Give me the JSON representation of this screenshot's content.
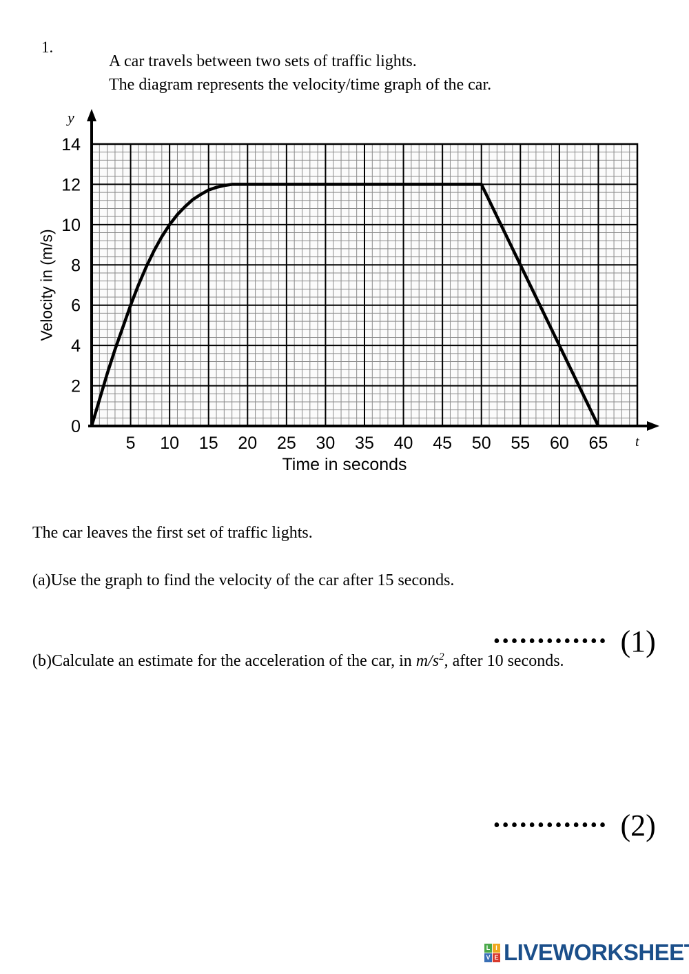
{
  "question": {
    "number": "1.",
    "lines": [
      "A car travels between two sets of traffic lights.",
      "The diagram represents the velocity/time graph of the car."
    ]
  },
  "body": {
    "lead": "The car leaves the first set of traffic lights.",
    "part_a": "(a)Use the graph to find the velocity of the car after 15 seconds.",
    "part_b_pre": "(b)Calculate an estimate for the acceleration of the car, in ",
    "part_b_units": "m/s",
    "part_b_exp": "2",
    "part_b_post": ", after 10 seconds.",
    "answer_dots": "•••••••••••••",
    "mark_a": "(1)",
    "mark_b": "(2)"
  },
  "footer": {
    "logo_tiles": [
      {
        "letter": "L",
        "color": "#4aa94a"
      },
      {
        "letter": "I",
        "color": "#f0a81e"
      },
      {
        "letter": "V",
        "color": "#3a6fb5"
      },
      {
        "letter": "E",
        "color": "#d83a2e"
      }
    ],
    "logo_word": "LIVEWORKSHEETS",
    "logo_word_color": "#1b4f8a"
  },
  "chart_data": {
    "type": "line",
    "title": "",
    "xlabel": "Time in seconds",
    "ylabel": "Velocity in (m/s)",
    "x_axis_symbol": "t",
    "y_axis_symbol": "y",
    "xlim": [
      0,
      70
    ],
    "ylim": [
      0,
      14
    ],
    "xticks": [
      5,
      10,
      15,
      20,
      25,
      30,
      35,
      40,
      45,
      50,
      55,
      60,
      65
    ],
    "yticks": [
      0,
      2,
      4,
      6,
      8,
      10,
      12,
      14
    ],
    "grid": "on",
    "grid_major_x": 5,
    "grid_minor_x": 1,
    "grid_major_y": 2,
    "grid_minor_y": 0.4,
    "series": [
      {
        "name": "velocity",
        "points": [
          [
            0,
            0
          ],
          [
            1,
            1.3
          ],
          [
            2,
            2.6
          ],
          [
            3,
            3.8
          ],
          [
            4,
            4.9
          ],
          [
            5,
            6.0
          ],
          [
            6,
            7.0
          ],
          [
            7,
            7.9
          ],
          [
            8,
            8.7
          ],
          [
            9,
            9.4
          ],
          [
            10,
            10.0
          ],
          [
            11,
            10.5
          ],
          [
            12,
            10.9
          ],
          [
            13,
            11.25
          ],
          [
            14,
            11.5
          ],
          [
            15,
            11.72
          ],
          [
            16,
            11.85
          ],
          [
            17,
            11.94
          ],
          [
            18,
            12.0
          ],
          [
            50,
            12.0
          ],
          [
            65,
            0
          ]
        ]
      }
    ],
    "annotations": [
      "constant velocity 12 m/s from t=18 s to t=50 s",
      "linear deceleration from (50, 12) to (65, 0)"
    ]
  }
}
